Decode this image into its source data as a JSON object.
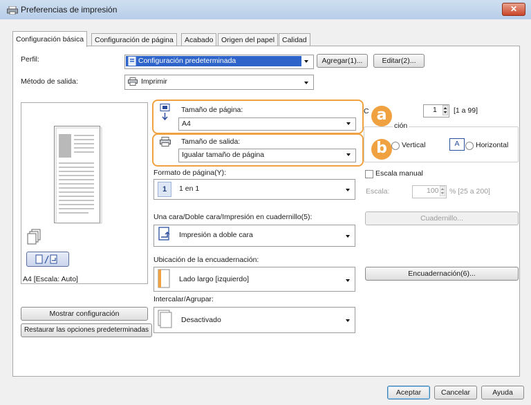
{
  "window": {
    "title": "Preferencias de impresión",
    "close_glyph": "✕"
  },
  "tabs": [
    {
      "label": "Configuración básica"
    },
    {
      "label": "Configuración de página"
    },
    {
      "label": "Acabado"
    },
    {
      "label": "Origen del papel"
    },
    {
      "label": "Calidad"
    }
  ],
  "profile": {
    "label": "Perfil:",
    "value": "Configuración predeterminada",
    "add_button": "Agregar(1)...",
    "edit_button": "Editar(2)..."
  },
  "output_method": {
    "label": "Método de salida:",
    "value": "Imprimir"
  },
  "page_size": {
    "label": "Tamaño de página:",
    "value": "A4"
  },
  "output_size": {
    "label": "Tamaño de salida:",
    "value": "Igualar tamaño de página"
  },
  "callouts": {
    "a": "a",
    "b": "b"
  },
  "page_layout": {
    "label": "Formato de página(Y):",
    "value": "1 en 1",
    "icon_text": "1"
  },
  "duplex": {
    "label": "Una cara/Doble cara/Impresión en cuadernillo(5):",
    "value": "Impresión a doble cara"
  },
  "binding_location": {
    "label": "Ubicación de la encuadernación:",
    "value": "Lado largo [izquierdo]"
  },
  "collate": {
    "label": "Intercalar/Agrupar:",
    "value": "Desactivado"
  },
  "copies": {
    "label": "C",
    "value": "1",
    "range": "[1 a 99]"
  },
  "orientation": {
    "group_label": "ción",
    "vertical": "Vertical",
    "horizontal": "Horizontal",
    "icon_letter": "A"
  },
  "manual_scaling": {
    "label": "Escala manual",
    "scale_label": "Escala:",
    "scale_value": "100",
    "scale_range": "% [25 a 200]"
  },
  "buttons": {
    "booklet": "Cuadernillo...",
    "binding": "Encuadernación(6)...",
    "show_settings": "Mostrar configuración",
    "restore_defaults": "Restaurar las opciones predeterminadas",
    "ok": "Aceptar",
    "cancel": "Cancelar",
    "help": "Ayuda"
  },
  "preview": {
    "caption": "A4 [Escala: Auto]"
  },
  "colors": {
    "accent_orange": "#f0a240",
    "selection_blue": "#2e63c9"
  }
}
